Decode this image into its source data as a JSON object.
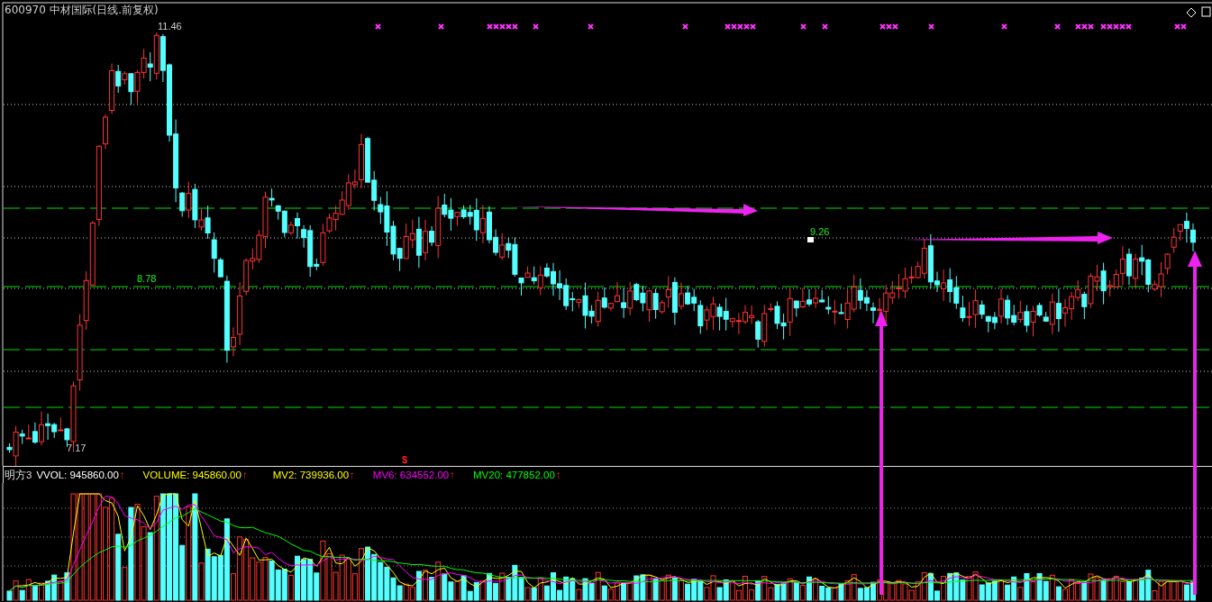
{
  "title": "600970 中材国际(日线.前复权)",
  "price_chart": {
    "high_label": "11.46",
    "low_label": "7.17",
    "levels": [
      {
        "label": "8.78"
      },
      {
        "label": "9.26"
      }
    ],
    "signal_mark": "$"
  },
  "indicator": {
    "name": "明方3",
    "items": [
      {
        "label": "VVOL: 945860.00",
        "trend": "↑",
        "color": "#ffffff"
      },
      {
        "label": "VOLUME: 945860.00",
        "trend": "↑",
        "color": "#ffff00"
      },
      {
        "label": "MV2: 739936.00",
        "trend": "↑",
        "color": "#ffff00"
      },
      {
        "label": "MV6: 634552.00",
        "trend": "↑",
        "color": "#ff00ff"
      },
      {
        "label": "MV20: 477852.00",
        "trend": "↑",
        "color": "#00ff00"
      }
    ]
  }
}
